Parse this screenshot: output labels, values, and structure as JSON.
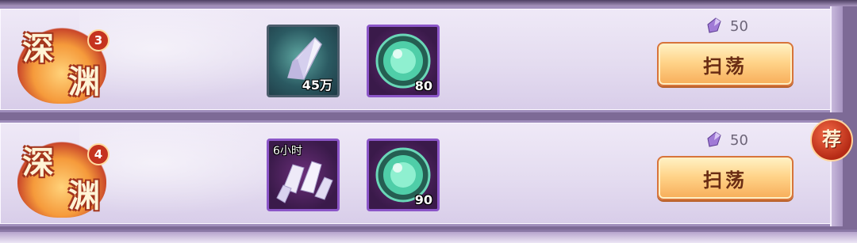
{
  "stages": [
    {
      "emblem_line1": "深",
      "emblem_line2": "渊",
      "level": "3",
      "reward1": {
        "icon": "crystal-shard-icon",
        "quantity": "45万"
      },
      "reward2": {
        "icon": "jade-orb-icon",
        "quantity": "80"
      },
      "cost": {
        "icon": "purple-gem-icon",
        "amount": "50"
      },
      "button_label": "扫荡"
    },
    {
      "emblem_line1": "深",
      "emblem_line2": "渊",
      "level": "4",
      "reward1": {
        "icon": "crystal-cluster-icon",
        "duration": "6小时"
      },
      "reward2": {
        "icon": "jade-orb-icon",
        "quantity": "90"
      },
      "cost": {
        "icon": "purple-gem-icon",
        "amount": "50"
      },
      "button_label": "扫荡"
    }
  ],
  "recommend_badge": "荐",
  "colors": {
    "accent_button": "#f7ad59",
    "badge": "#b52a15",
    "row_bg": "#e4dcf0"
  }
}
